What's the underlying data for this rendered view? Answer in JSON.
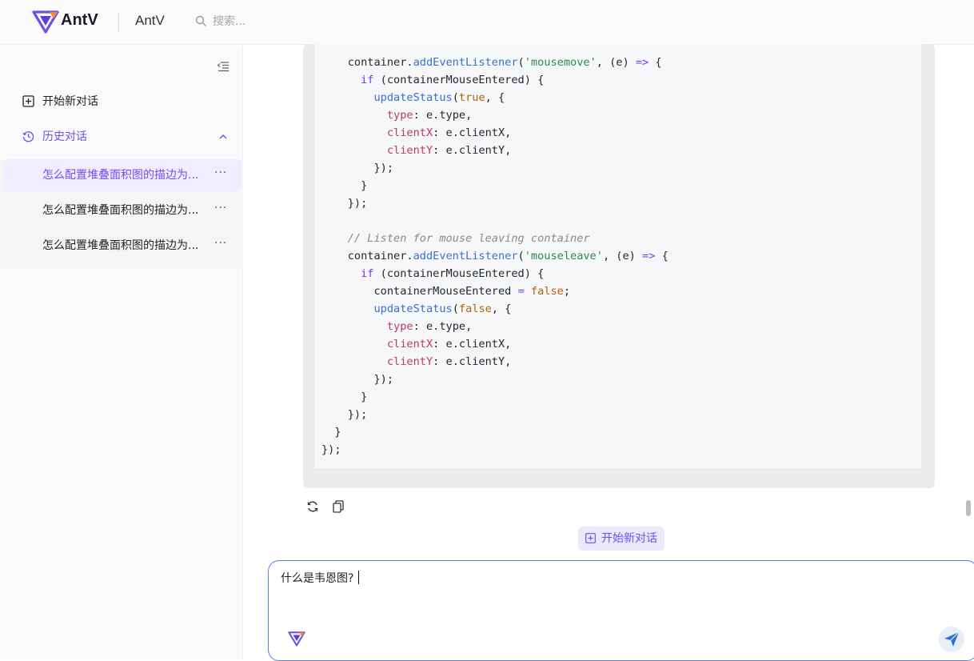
{
  "header": {
    "brand": "AntV",
    "site_title": "AntV",
    "search_placeholder": "搜索..."
  },
  "sidebar": {
    "new_chat_label": "开始新对话",
    "history_label": "历史对话",
    "conversations": [
      {
        "title": "怎么配置堆叠面积图的描边为...",
        "more": "···"
      },
      {
        "title": "怎么配置堆叠面积图的描边为...",
        "more": "···"
      },
      {
        "title": "怎么配置堆叠面积图的描边为...",
        "more": "···"
      }
    ]
  },
  "main": {
    "new_chat_chip_label": "开始新对话",
    "composer_value": "什么是韦恩图?"
  },
  "colors": {
    "accent": "#6e4ff0",
    "active_bg": "#f1ecff",
    "composer_border": "#5b7be8",
    "send_icon": "#2f6fd6"
  }
}
